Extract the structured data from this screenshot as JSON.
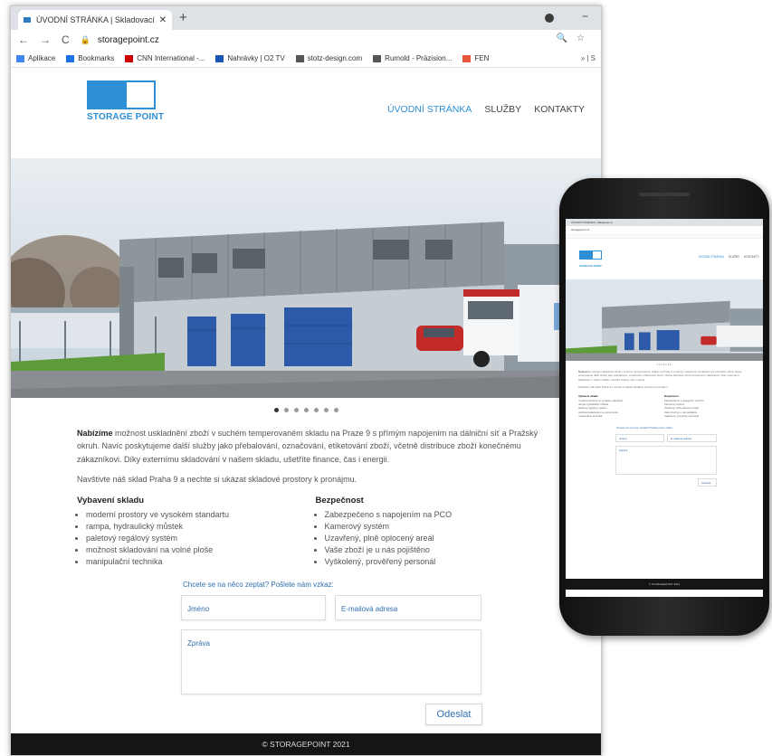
{
  "browser": {
    "tab_title": "ÚVODNÍ STRÁNKA | Skladovací p",
    "tab_close": "✕",
    "new_tab": "+",
    "url": "storagepoint.cz",
    "bookmarks": [
      {
        "label": "Aplikace",
        "color": "#4285f4"
      },
      {
        "label": "Bookmarks",
        "color": "#1a73e8"
      },
      {
        "label": "CNN International -...",
        "color": "#cc0000"
      },
      {
        "label": "Nahrávky | O2 TV",
        "color": "#1c54b2"
      },
      {
        "label": "stotz-design.com",
        "color": "#555555"
      },
      {
        "label": "Rumold - Präzision...",
        "color": "#555555"
      },
      {
        "label": "FEN",
        "color": "#e8543b"
      }
    ],
    "bookmarks_more": "» | S"
  },
  "site": {
    "logo_text": "STORAGE POINT",
    "nav": [
      "ÚVODNÍ STRÁNKA",
      "SLUŽBY",
      "KONTAKTY"
    ],
    "slider_dots": 7,
    "intro_bold": "Nabízíme",
    "intro_rest": " možnost uskladnění zboží v suchém temperovaném skladu na Praze 9 s přímým napojením na dálniční síť a Pražský okruh. Navíc poskytujeme další služby jako přebalování, označování, etiketování zboží, včetně distribuce zboží konečnému zákazníkovi. Díky externímu skladování v našem skladu, ušetříte finance, čas i energii.",
    "visit": "Navštivte náš sklad Praha 9 a nechte si ukázat skladové prostory k pronájmu.",
    "col1_title": "Vybavení skladu",
    "col1": [
      "moderní prostory ve vysokém standartu",
      "rampa, hydraulický můstek",
      "paletový regálový systém",
      "možnost skladování na volné ploše",
      "manipulační technika"
    ],
    "col2_title": "Bezpečnost",
    "col2": [
      "Zabezpečeno s napojením na PCO",
      "Kamerový systém",
      "Uzavřený, plně oplocený areál",
      "Vaše zboží je u nás pojištěno",
      "Vyškolený, prověřený personál"
    ],
    "form_prompt": "Chcete se na něco zeptat? Pošlete nám vzkaz:",
    "name_placeholder": "Jméno",
    "email_placeholder": "E-mailová adresa",
    "message_placeholder": "Zpráva",
    "send": "Odeslat",
    "footer": "© STORAGEPOINT 2021"
  },
  "phone": {
    "tab_title": "ÚVODNÍ STRÁNKA | Skladovací p",
    "url": "storagepoint.cz",
    "logo_text": "STORAGE POINT",
    "nav": [
      "ÚVODNÍ STRÁNKA",
      "SLUŽBY",
      "KONTAKTY"
    ],
    "footer": "© STORAGEPOINT 2021"
  },
  "colors": {
    "accent": "#2f8fd4",
    "link": "#2f6fb0",
    "footer_bg": "#151515"
  }
}
